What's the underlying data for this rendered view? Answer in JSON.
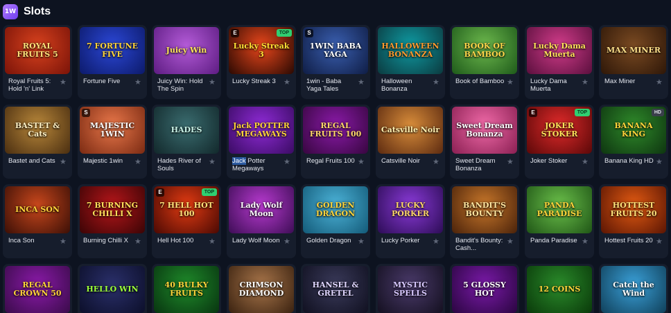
{
  "header": {
    "logo_text": "1W",
    "title": "Slots"
  },
  "games": [
    {
      "name": "Royal Fruits 5: Hold 'n' Link",
      "art": "ROYAL FRUITS 5",
      "bg": [
        "#d8421e",
        "#7a1308"
      ],
      "fg": "#ffe27a"
    },
    {
      "name": "Fortune Five",
      "art": "7 FORTUNE FIVE",
      "bg": [
        "#2b47d6",
        "#0c1a6a"
      ],
      "fg": "#ffd43a"
    },
    {
      "name": "Juicy Win: Hold The Spin",
      "art": "Juicy Win",
      "bg": [
        "#b45bd8",
        "#5d1c82"
      ],
      "fg": "#ffe55c",
      "badge": ""
    },
    {
      "name": "Lucky Streak 3",
      "art": "Lucky Streak 3",
      "bg": [
        "#e8461b",
        "#2a0902"
      ],
      "fg": "#ffe135",
      "badge": "TOP",
      "prov": "E"
    },
    {
      "name": "1win - Baba Yaga Tales",
      "art": "1WIN BABA YAGA",
      "bg": [
        "#3a5fb0",
        "#0f1d45"
      ],
      "fg": "#ffffff",
      "prov": "S"
    },
    {
      "name": "Halloween Bonanza",
      "art": "HALLOWEEN BONANZA",
      "bg": [
        "#0f9aa2",
        "#0b3a3f"
      ],
      "fg": "#ff9a2e"
    },
    {
      "name": "Book of Bamboo",
      "art": "BOOK OF BAMBOO",
      "bg": [
        "#6db94d",
        "#1e5a1a"
      ],
      "fg": "#ffd64a"
    },
    {
      "name": "Lucky Dama Muerta",
      "art": "Lucky Dama Muerta",
      "bg": [
        "#d23c8a",
        "#5a0f3d"
      ],
      "fg": "#ffe35a"
    },
    {
      "name": "Max Miner",
      "art": "MAX MINER",
      "bg": [
        "#7a4a22",
        "#2e1708"
      ],
      "fg": "#ffe08a"
    },
    {
      "name": "Bastet and Cats",
      "art": "BASTET & Cats",
      "bg": [
        "#b8873a",
        "#4a2e10"
      ],
      "fg": "#fff1c4"
    },
    {
      "name": "Majestic 1win",
      "art": "MAJESTIC 1WIN",
      "bg": [
        "#e9774a",
        "#7a2a12"
      ],
      "fg": "#ffffff",
      "prov": "S"
    },
    {
      "name": "Hades River of Souls",
      "art": "HADES",
      "bg": [
        "#3a6c6f",
        "#12282b"
      ],
      "fg": "#c8f2e6"
    },
    {
      "name": "Jack Potter Megaways",
      "name_hl": "Jack",
      "name_rest": " Potter Megaways",
      "art": "Jack POTTER MEGAWAYS",
      "bg": [
        "#8f2bd6",
        "#3a0b63"
      ],
      "fg": "#ffd43a"
    },
    {
      "name": "Regal Fruits 100",
      "art": "REGAL FRUITS 100",
      "bg": [
        "#8a1aa8",
        "#37063f"
      ],
      "fg": "#ffd76a"
    },
    {
      "name": "Catsville Noir",
      "art": "Catsville Noir",
      "bg": [
        "#d98d3a",
        "#5c2a10"
      ],
      "fg": "#fff0b0"
    },
    {
      "name": "Sweet Dream Bonanza",
      "art": "Sweet Dream Bonanza",
      "bg": [
        "#f06aa8",
        "#8a1f52"
      ],
      "fg": "#ffffff"
    },
    {
      "name": "Joker Stoker",
      "art": "JOKER STOKER",
      "bg": [
        "#e02a2a",
        "#5a0808"
      ],
      "fg": "#ffe35a",
      "badge": "TOP",
      "prov": "E"
    },
    {
      "name": "Banana King HD",
      "art": "BANANA KING",
      "bg": [
        "#2f8a2a",
        "#0e3510"
      ],
      "fg": "#ffd43a",
      "badge": "HD"
    },
    {
      "name": "Inca Son",
      "art": "INCA SON",
      "bg": [
        "#c8471c",
        "#3b0f06"
      ],
      "fg": "#ffd43a"
    },
    {
      "name": "Burning Chilli X",
      "art": "7 BURNING CHILLI X",
      "bg": [
        "#b5161a",
        "#3a0405"
      ],
      "fg": "#ffdf5a"
    },
    {
      "name": "Hell Hot 100",
      "art": "7 HELL HOT 100",
      "bg": [
        "#e23b12",
        "#4a0903"
      ],
      "fg": "#ffe27a",
      "badge": "TOP",
      "prov": "E"
    },
    {
      "name": "Lady Wolf Moon",
      "art": "Lady Wolf Moon",
      "bg": [
        "#b83ad0",
        "#3d0d55"
      ],
      "fg": "#ffffff"
    },
    {
      "name": "Golden Dragon",
      "art": "GOLDEN DRAGON",
      "bg": [
        "#4cb3d8",
        "#135a78"
      ],
      "fg": "#ffd43a"
    },
    {
      "name": "Lucky Porker",
      "art": "LUCKY PORKER",
      "bg": [
        "#8a3ad8",
        "#2c0c55"
      ],
      "fg": "#ffd76a"
    },
    {
      "name": "Bandit's Bounty: Cash...",
      "art": "BANDIT'S BOUNTY",
      "bg": [
        "#c8772a",
        "#4a220a"
      ],
      "fg": "#ffe6a0"
    },
    {
      "name": "Panda Paradise",
      "art": "PANDA PARADISE",
      "bg": [
        "#6bc04a",
        "#1f5516"
      ],
      "fg": "#ffd43a"
    },
    {
      "name": "Hottest Fruits 20",
      "art": "HOTTEST FRUITS 20",
      "bg": [
        "#e25a12",
        "#5a1503"
      ],
      "fg": "#ffe27a"
    },
    {
      "name": "",
      "art": "REGAL CROWN 50",
      "bg": [
        "#8a1aa8",
        "#3a0b4a"
      ],
      "fg": "#ffd43a"
    },
    {
      "name": "",
      "art": "HELLO WIN",
      "bg": [
        "#2a2f6a",
        "#0c0f2a"
      ],
      "fg": "#9cff3a"
    },
    {
      "name": "",
      "art": "40 BULKY FRUITS",
      "bg": [
        "#1f8a2a",
        "#083510"
      ],
      "fg": "#ffd43a"
    },
    {
      "name": "",
      "art": "CRIMSON DIAMOND",
      "bg": [
        "#a8754a",
        "#3a2210"
      ],
      "fg": "#ffffff"
    },
    {
      "name": "",
      "art": "HANSEL & GRETEL",
      "bg": [
        "#3a3a5a",
        "#101020"
      ],
      "fg": "#e0d6ff"
    },
    {
      "name": "",
      "art": "MYSTIC SPELLS",
      "bg": [
        "#4a3a6a",
        "#141020"
      ],
      "fg": "#d8c8ff"
    },
    {
      "name": "",
      "art": "5 GLOSSY HOT",
      "bg": [
        "#7a1aa8",
        "#2a0540"
      ],
      "fg": "#ffffff"
    },
    {
      "name": "",
      "art": "12 COINS",
      "bg": [
        "#2a8a2a",
        "#0a3a0a"
      ],
      "fg": "#ffd43a"
    },
    {
      "name": "",
      "art": "Catch the Wind",
      "bg": [
        "#3aa0d8",
        "#10405a"
      ],
      "fg": "#ffffff"
    }
  ]
}
